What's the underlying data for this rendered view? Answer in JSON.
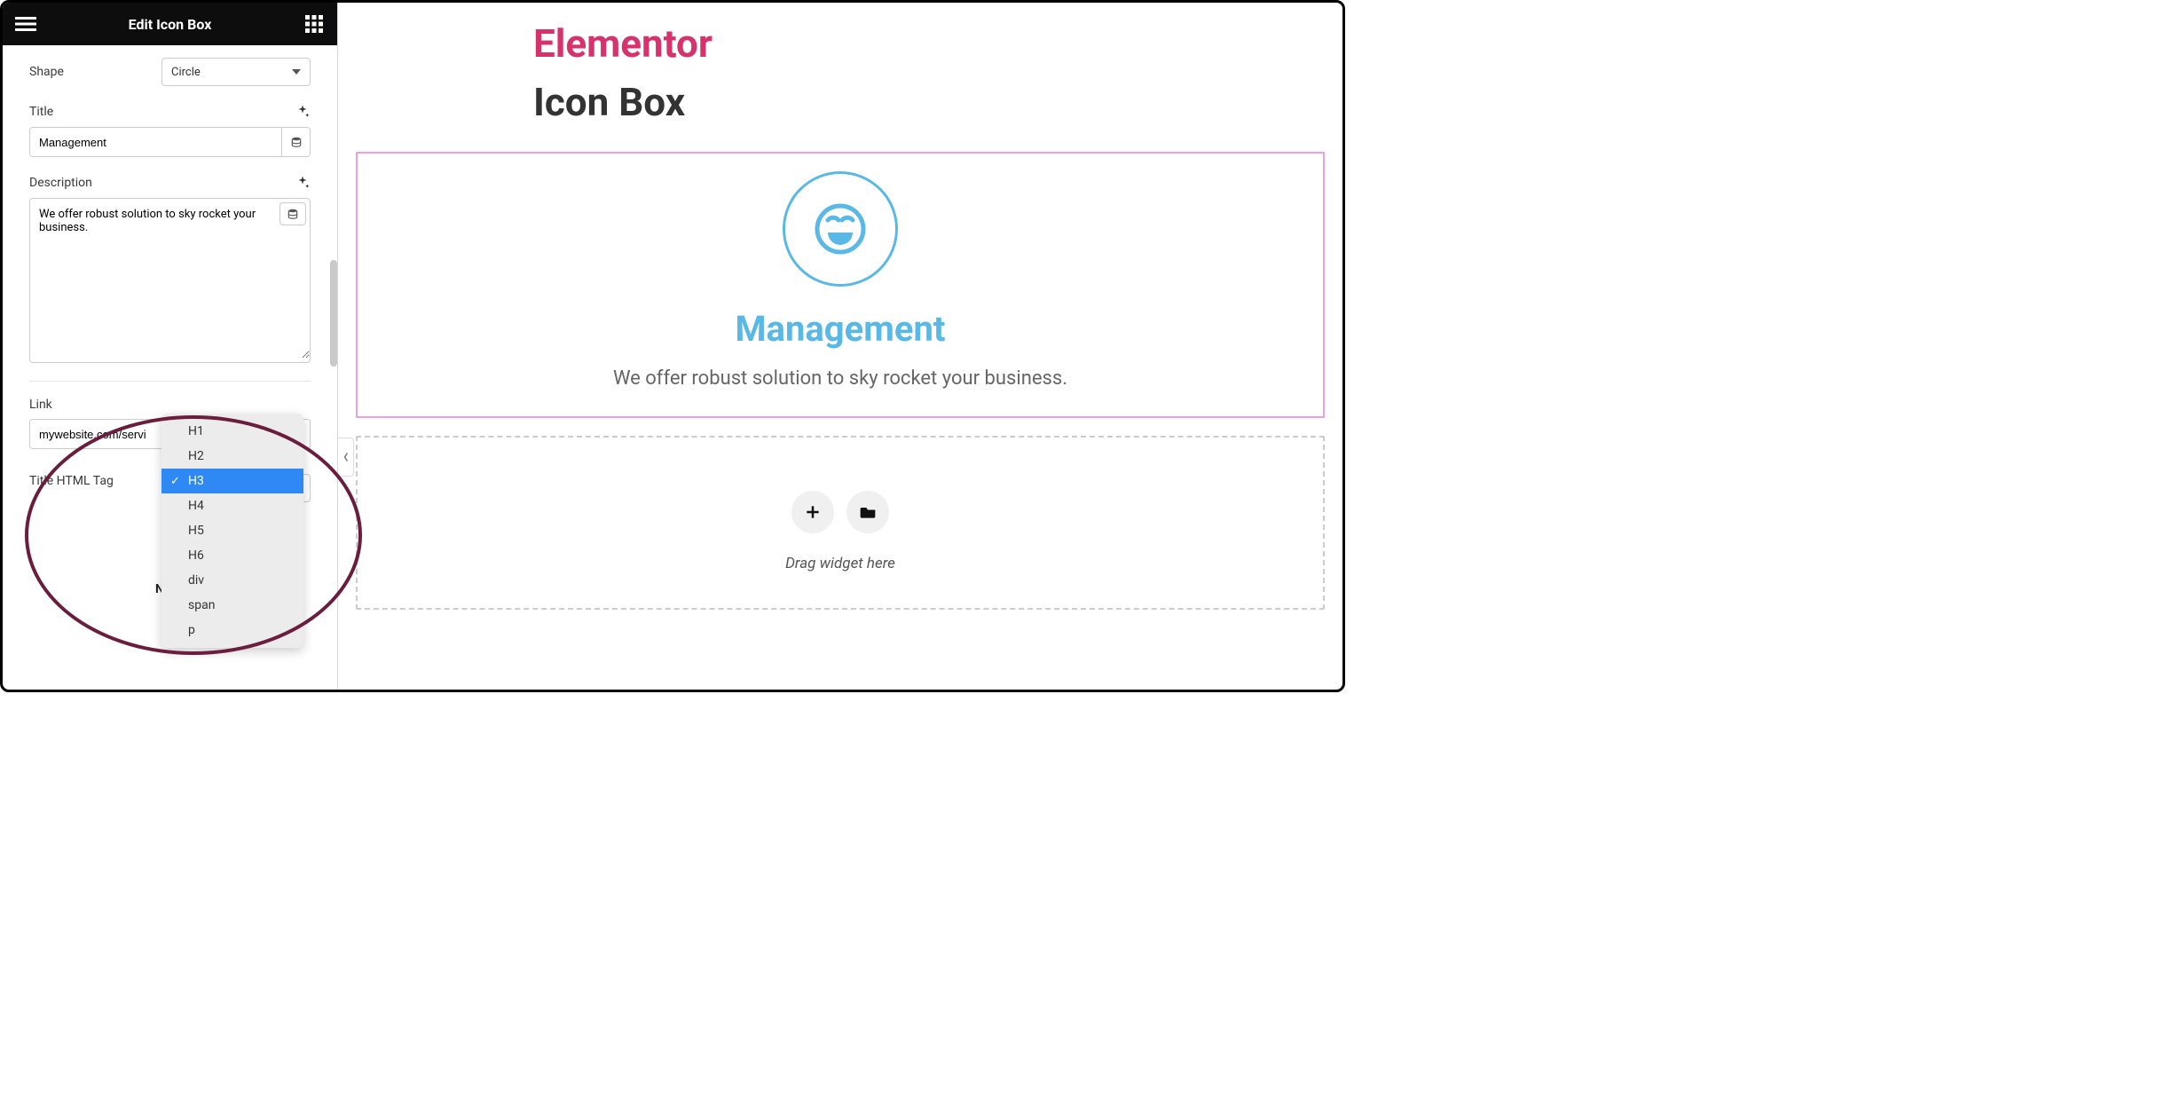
{
  "header": {
    "title": "Edit Icon Box"
  },
  "controls": {
    "shape": {
      "label": "Shape",
      "value": "Circle"
    },
    "title": {
      "label": "Title",
      "value": "Management"
    },
    "description": {
      "label": "Description",
      "value": "We offer robust solution to sky rocket your business."
    },
    "link": {
      "label": "Link",
      "value": "mywebsite.com/servi"
    },
    "titleTag": {
      "label": "Title HTML Tag",
      "selected": "H3",
      "options": [
        "H1",
        "H2",
        "H3",
        "H4",
        "H5",
        "H6",
        "div",
        "span",
        "p"
      ]
    }
  },
  "footerNeedHelp": "Need",
  "canvas": {
    "brand": "Elementor",
    "pageTitle": "Icon Box",
    "widget": {
      "title": "Management",
      "description": "We offer robust solution to sky rocket your business."
    },
    "dropZoneText": "Drag widget here"
  },
  "colors": {
    "brand": "#d6336c",
    "accentBlue": "#59b8e6",
    "selectBorder": "#ef9ee4",
    "dropdownSelected": "#2f89f5",
    "annotation": "#6a1d3d"
  }
}
